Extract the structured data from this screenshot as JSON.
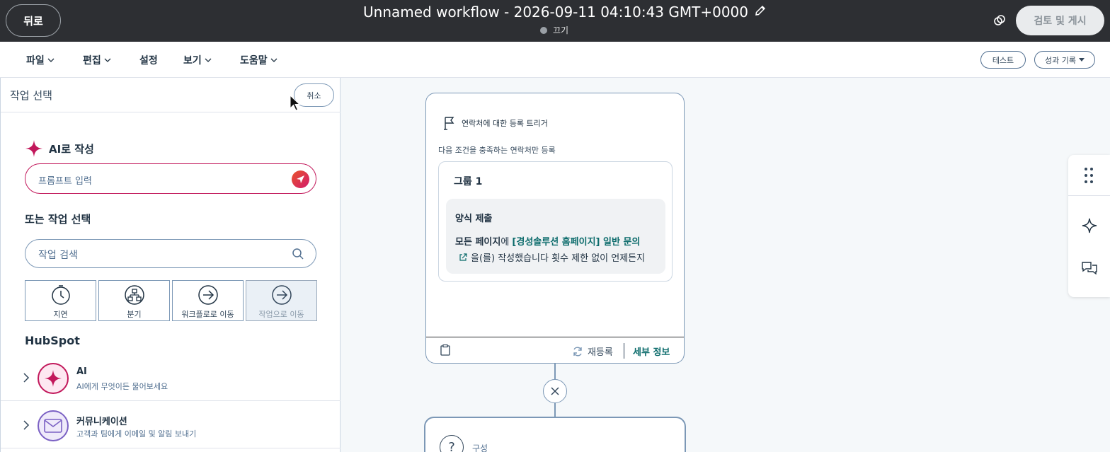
{
  "topbar": {
    "back_label": "뒤로",
    "workflow_title": "Unnamed workflow - 2026-09-11 04:10:43 GMT+0000",
    "status": "끄기",
    "publish_label": "검토 및 게시"
  },
  "menubar": {
    "items": [
      "파일",
      "편집",
      "설정",
      "보기",
      "도움말"
    ],
    "test_label": "테스트",
    "performance_label": "성과 기록"
  },
  "panel": {
    "title": "작업 선택",
    "cancel_label": "취소",
    "ai_heading": "AI로 작성",
    "prompt_placeholder": "프롬프트 입력",
    "or_heading": "또는 작업 선택",
    "search_placeholder": "작업 검색",
    "actions": [
      {
        "label": "지연",
        "icon": "timer-icon"
      },
      {
        "label": "분기",
        "icon": "branch-icon"
      },
      {
        "label": "워크플로로 이동",
        "icon": "arrow-right-circle-icon"
      },
      {
        "label": "작업으로 이동",
        "icon": "arrow-right-circle-icon"
      }
    ],
    "hubspot_heading": "HubSpot",
    "categories": [
      {
        "name": "AI",
        "description": "AI에게 무엇이든 물어보세요",
        "icon": "sparkle-icon"
      },
      {
        "name": "커뮤니케이션",
        "description": "고객과 팀에게 이메일 및 알림 보내기",
        "icon": "envelope-icon"
      }
    ]
  },
  "trigger": {
    "title": "연락처에 대한 등록 트리거",
    "subtitle": "다음 조건을 충족하는 연락처만 등록",
    "group_title": "그룹 1",
    "filter_title": "양식 제출",
    "filter_part1": "모든 페이지",
    "filter_part2": "에 ",
    "filter_form": "[경성솔루션 홈페이지] 일반 문의",
    "filter_part3": "을(를) 작성했습니다 횟수 제한 없이 언제든지",
    "reenroll_label": "재등록",
    "details_label": "세부 정보"
  },
  "config": {
    "label": "구성"
  },
  "colors": {
    "topbar_bg": "#2d2f33",
    "ai_accent": "#c2185b",
    "link_teal": "#0b6b6b"
  }
}
